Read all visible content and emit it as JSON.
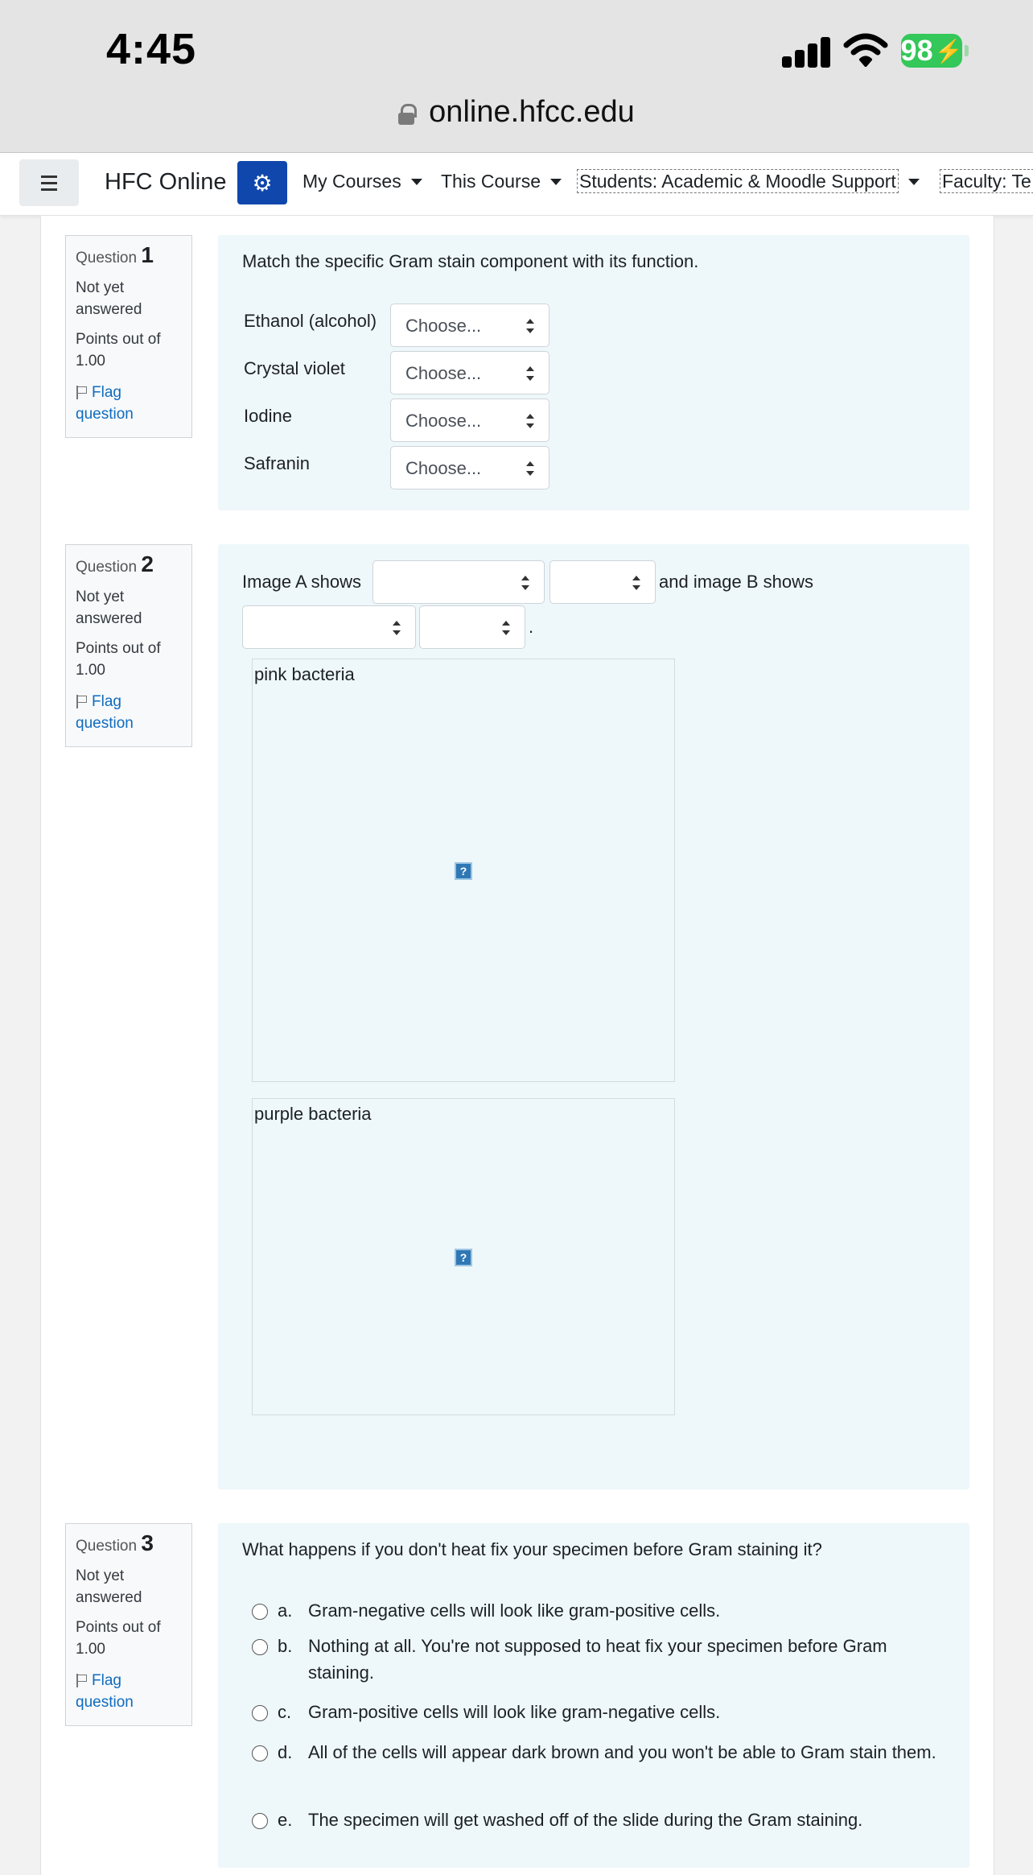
{
  "status_bar": {
    "time": "4:45",
    "battery": "98"
  },
  "browser": {
    "url": "online.hfcc.edu"
  },
  "navbar": {
    "brand": "HFC Online",
    "items": [
      "My Courses",
      "This Course",
      "Students: Academic & Moodle Support",
      "Faculty: Te"
    ]
  },
  "questions": [
    {
      "label": "Question",
      "number": "1",
      "status": "Not yet answered",
      "points": "Points out of 1.00",
      "flag": "Flag question",
      "text": "Match the specific Gram stain component with its function.",
      "matches": [
        {
          "label": "Ethanol (alcohol)",
          "select": "Choose..."
        },
        {
          "label": "Crystal violet",
          "select": "Choose..."
        },
        {
          "label": "Iodine",
          "select": "Choose..."
        },
        {
          "label": "Safranin",
          "select": "Choose..."
        }
      ]
    },
    {
      "label": "Question",
      "number": "2",
      "status": "Not yet answered",
      "points": "Points out of 1.00",
      "flag": "Flag question",
      "text_a": "Image A shows",
      "text_b": "and image B shows",
      "text_end": ".",
      "image_a_caption": "pink bacteria",
      "image_b_caption": "purple bacteria",
      "broken_image_glyph": "?"
    },
    {
      "label": "Question",
      "number": "3",
      "status": "Not yet answered",
      "points": "Points out of 1.00",
      "flag": "Flag question",
      "text": "What happens if you don't heat fix your specimen before Gram staining it?",
      "options": [
        {
          "letter": "a.",
          "text": "Gram-negative cells will look like gram-positive cells."
        },
        {
          "letter": "b.",
          "text": "Nothing at all.  You're not supposed to heat fix your specimen before Gram staining."
        },
        {
          "letter": "c.",
          "text": "Gram-positive cells will look like gram-negative cells."
        },
        {
          "letter": "d.",
          "text": "All of the cells will appear dark brown and you won't be able to Gram stain them."
        },
        {
          "letter": "e.",
          "text": "The specimen will get washed off of the slide during the Gram staining."
        }
      ]
    }
  ],
  "colors": {
    "nav_blue": "#0f47ad",
    "link": "#0f6cbf",
    "question_bg": "#eef7f9",
    "battery_green": "#34c759"
  }
}
